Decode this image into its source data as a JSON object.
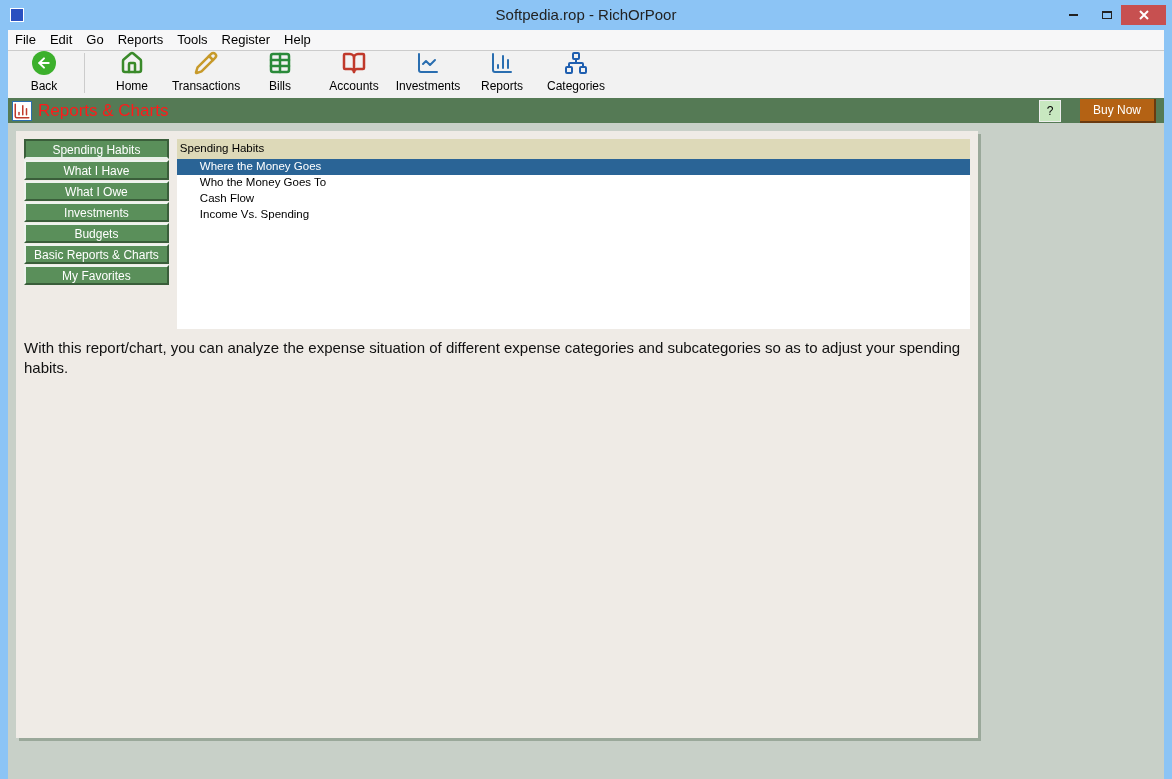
{
  "window": {
    "title": "Softpedia.rop - RichOrPoor"
  },
  "menu": [
    "File",
    "Edit",
    "Go",
    "Reports",
    "Tools",
    "Register",
    "Help"
  ],
  "toolbar": [
    {
      "kind": "back",
      "label": "Back"
    },
    {
      "kind": "home",
      "label": "Home"
    },
    {
      "kind": "transactions",
      "label": "Transactions"
    },
    {
      "kind": "bills",
      "label": "Bills"
    },
    {
      "kind": "accounts",
      "label": "Accounts"
    },
    {
      "kind": "investments",
      "label": "Investments"
    },
    {
      "kind": "reports",
      "label": "Reports"
    },
    {
      "kind": "categories",
      "label": "Categories"
    }
  ],
  "header": {
    "title": "Reports & Charts",
    "help": "?",
    "buy": "Buy Now"
  },
  "sidebar": [
    {
      "label": "Spending Habits",
      "selected": true
    },
    {
      "label": "What I Have",
      "selected": false
    },
    {
      "label": "What I Owe",
      "selected": false
    },
    {
      "label": "Investments",
      "selected": false
    },
    {
      "label": "Budgets",
      "selected": false
    },
    {
      "label": "Basic Reports & Charts",
      "selected": false
    },
    {
      "label": "My Favorites",
      "selected": false
    }
  ],
  "list": {
    "heading": "Spending Habits",
    "items": [
      {
        "label": "Where the Money Goes",
        "selected": true
      },
      {
        "label": "Who the Money Goes To",
        "selected": false
      },
      {
        "label": "Cash Flow",
        "selected": false
      },
      {
        "label": "Income Vs. Spending",
        "selected": false
      }
    ]
  },
  "description": "With this report/chart, you can analyze the expense situation of different expense categories and subcategories so as to adjust your spending habits."
}
